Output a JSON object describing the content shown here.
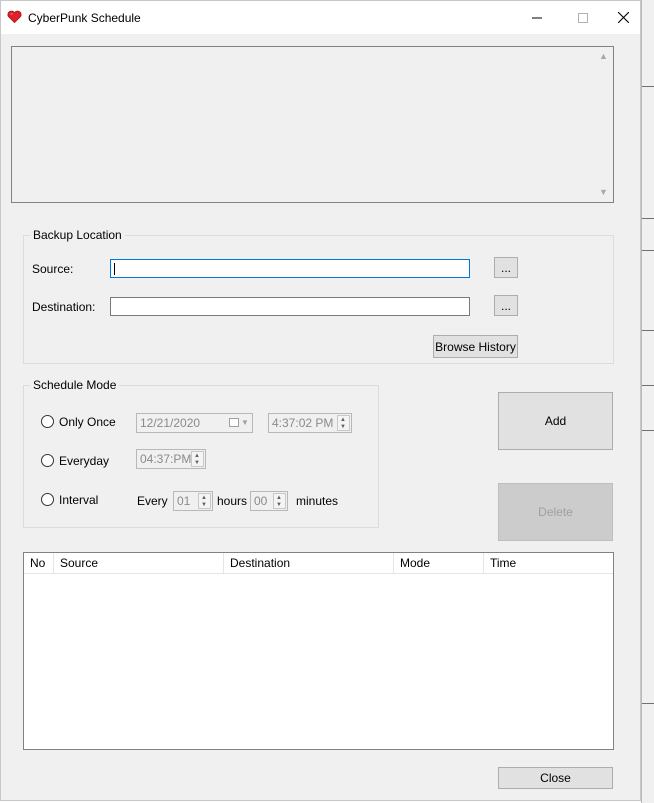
{
  "window": {
    "title": "CyberPunk Schedule",
    "minimize_icon": "minimize-icon",
    "maximize_icon": "maximize-icon",
    "close_icon": "close-icon",
    "app_icon": "heart-icon",
    "app_icon_color": "#e0212a"
  },
  "log": {
    "text": ""
  },
  "backup_location": {
    "title": "Backup Location",
    "source_label": "Source:",
    "source_value": "",
    "destination_label": "Destination:",
    "destination_value": "",
    "browse_label": "...",
    "browse_history_label": "Browse History"
  },
  "schedule_mode": {
    "title": "Schedule Mode",
    "only_once_label": "Only Once",
    "only_once_date": "12/21/2020",
    "only_once_time": "4:37:02 PM",
    "everyday_label": "Everyday",
    "everyday_time": "04:37:PM",
    "interval_label": "Interval",
    "every_label": "Every",
    "hours_value": "01",
    "hours_label": "hours",
    "minutes_value": "00",
    "minutes_label": "minutes"
  },
  "actions": {
    "add_label": "Add",
    "delete_label": "Delete",
    "close_label": "Close"
  },
  "table": {
    "columns": [
      "No",
      "Source",
      "Destination",
      "Mode",
      "Time"
    ],
    "rows": []
  }
}
